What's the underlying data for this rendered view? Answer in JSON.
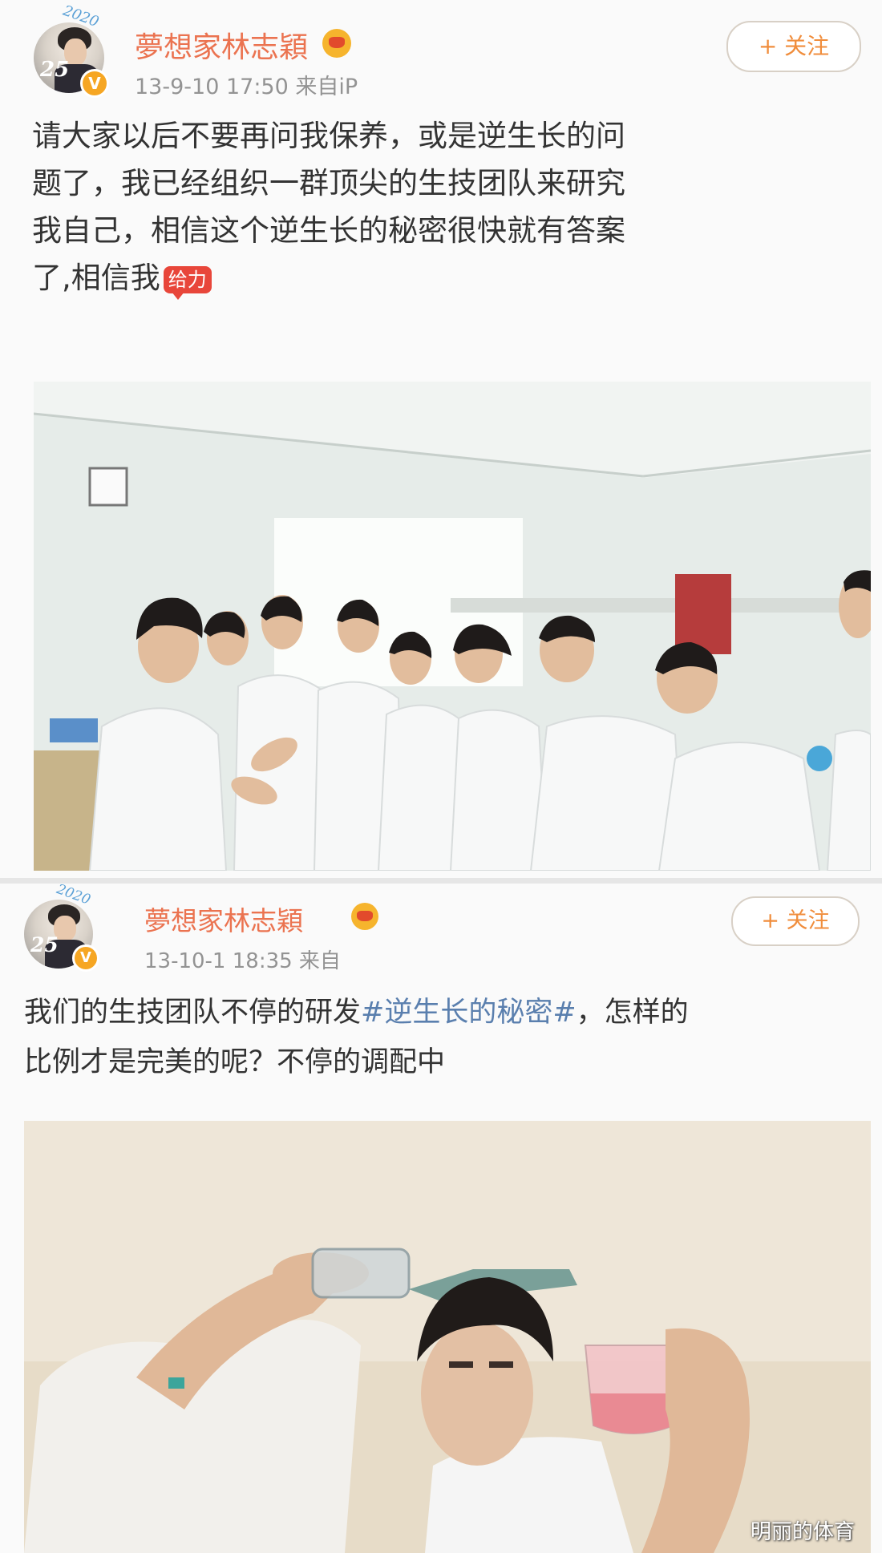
{
  "posts": [
    {
      "avatar": {
        "badge_text": "25",
        "badge_year": "2020",
        "verified": "V"
      },
      "username": "夢想家林志穎",
      "meta": "13-9-10 17:50  来自iP",
      "follow_label": "+ 关注",
      "content_lines": [
        "请大家以后不要再问我保养，或是逆生长的问",
        "题了，我已经组织一群顶尖的生技团队来研究",
        "我自己，相信这个逆生长的秘密很快就有答案",
        "了,相信我"
      ],
      "emoji_label": "给力",
      "photo_icon": "lab-group-photo"
    },
    {
      "avatar": {
        "badge_text": "25",
        "badge_year": "2020",
        "verified": "V"
      },
      "username": "夢想家林志穎",
      "meta": "13-10-1 18:35  来自",
      "follow_label": "+ 关注",
      "content_line1_before": "我们的生技团队不停的研发",
      "hashtag": "#逆生长的秘密#",
      "content_line1_after": "，怎样的",
      "content_line2": "比例才是完美的呢？不停的调配中",
      "photo_icon": "beaker-mixing-photo"
    }
  ],
  "watermark": "明丽的体育",
  "colors": {
    "username": "#eb7350",
    "hashtag": "#5a7fae",
    "follow": "#f08d3c",
    "meta": "#939393"
  }
}
